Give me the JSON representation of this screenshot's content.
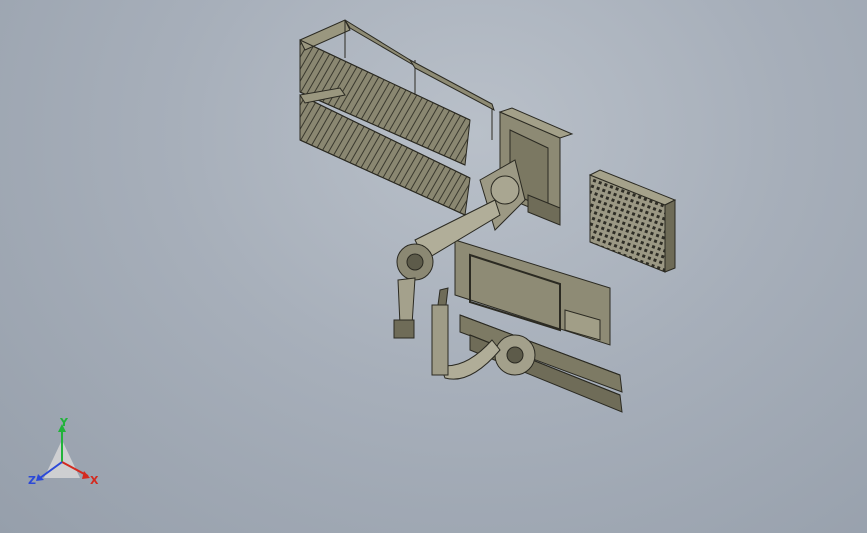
{
  "viewport": {
    "background_top": "#b9c0c9",
    "background_bottom": "#969fab",
    "model_color": "#8d8a74",
    "model_edge": "#2b2a22"
  },
  "triad": {
    "x_label": "X",
    "y_label": "Y",
    "z_label": "Z",
    "x_color": "#d42a1f",
    "y_color": "#21b33a",
    "z_color": "#2c49d8"
  }
}
